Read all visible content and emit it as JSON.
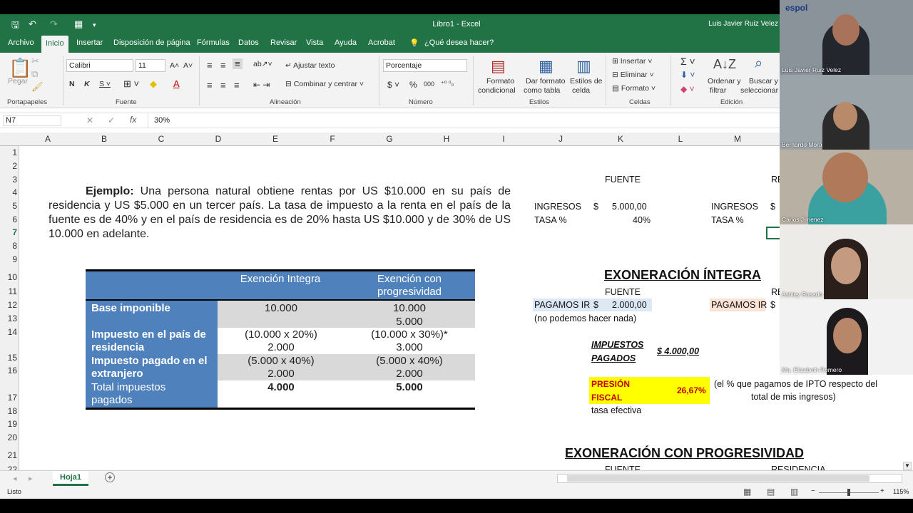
{
  "titlebar": {
    "title": "Libro1  -  Excel",
    "user": "Luis Javier Ruiz Velez"
  },
  "tabs": [
    "Archivo",
    "Inicio",
    "Insertar",
    "Disposición de página",
    "Fórmulas",
    "Datos",
    "Revisar",
    "Vista",
    "Ayuda",
    "Acrobat",
    "¿Qué desea hacer?"
  ],
  "ribbon": {
    "paste": "Pegar",
    "font": "Calibri",
    "size": "11",
    "align_wrap": "Ajustar texto",
    "merge": "Combinar y centrar",
    "numfmt": "Porcentaje",
    "cond1": "Formato",
    "cond2": "condicional",
    "tbl1": "Dar formato",
    "tbl2": "como tabla",
    "sty1": "Estilos de",
    "sty2": "celda",
    "insert": "Insertar",
    "delete": "Eliminar",
    "format": "Formato",
    "sort1": "Ordenar y",
    "sort2": "filtrar",
    "find1": "Buscar y",
    "find2": "seleccionar",
    "groups": [
      "Portapapeles",
      "Fuente",
      "Alineación",
      "Número",
      "Estilos",
      "Celdas",
      "Edición"
    ]
  },
  "formula": {
    "namebox": "N7",
    "fx": "fx",
    "value": "30%"
  },
  "columns": [
    "A",
    "B",
    "C",
    "D",
    "E",
    "F",
    "G",
    "H",
    "I",
    "J",
    "K",
    "L",
    "M"
  ],
  "rows": [
    "1",
    "2",
    "3",
    "4",
    "5",
    "6",
    "7",
    "8",
    "9",
    "10",
    "11",
    "12",
    "13",
    "14",
    "15",
    "16",
    "17",
    "18",
    "19",
    "20",
    "21",
    "22"
  ],
  "example": {
    "bold": "Ejemplo:",
    "text": " Una persona natural obtiene rentas por US $10.000 en su país de residencia y US $5.000 en un tercer país. La tasa de impuesto a la renta en el país de la fuente es de 40% y en el país de residencia es de 20% hasta US $10.000 y de 30% de US 10.000 en adelante."
  },
  "table": {
    "h1": "Exención Integra",
    "h2": "Exención con progresividad",
    "r1": {
      "label": "Base imponible",
      "a": "10.000",
      "b1": "10.000",
      "b2": "5.000"
    },
    "r2": {
      "label": "Impuesto en el país de residencia",
      "a1": "(10.000 x 20%)",
      "a2": "2.000",
      "b1": "(10.000 x 30%)*",
      "b2": "3.000"
    },
    "r3": {
      "label": "Impuesto pagado en el extranjero",
      "a1": "(5.000 x 40%)",
      "a2": "2.000",
      "b1": "(5.000 x 40%)",
      "b2": "2.000"
    },
    "r4": {
      "label": "Total impuestos pagados",
      "a": "4.000",
      "b": "5.000"
    }
  },
  "sheet": {
    "fuente": "FUENTE",
    "re": "RE",
    "ingresos": "INGRESOS",
    "dollar": "$",
    "ing_val": "5.000,00",
    "tasa": "TASA %",
    "tasa_val": "40%",
    "exon_integra": "EXONERACIÓN ÍNTEGRA",
    "pagamos": "PAGAMOS IR",
    "pag_val": "2.000,00",
    "no_podemos": "(no podemos hacer nada)",
    "imp1": "IMPUESTOS",
    "imp2": "PAGADOS",
    "imp_val": "$  4.000,00",
    "presion1": "PRESIÓN",
    "presion2": "FISCAL",
    "presion_val": "26,67%",
    "nota1": "(el % que pagamos de IPTO respecto del",
    "nota2": "total de mis ingresos)",
    "tasa_ef": "tasa efectiva",
    "exon_prog": "EXONERACIÓN CON PROGRESIVIDAD",
    "residencia": "RESIDENCIA"
  },
  "sheet_tab": "Hoja1",
  "status": {
    "ready": "Listo",
    "zoom": "115%"
  },
  "participants": [
    "Luis Javier Ruiz Velez",
    "Bernardo Mora",
    "Carlos Jimenez",
    "Ashley Rosado",
    "Ma. Elizabeth Romero"
  ],
  "espol": "espol"
}
